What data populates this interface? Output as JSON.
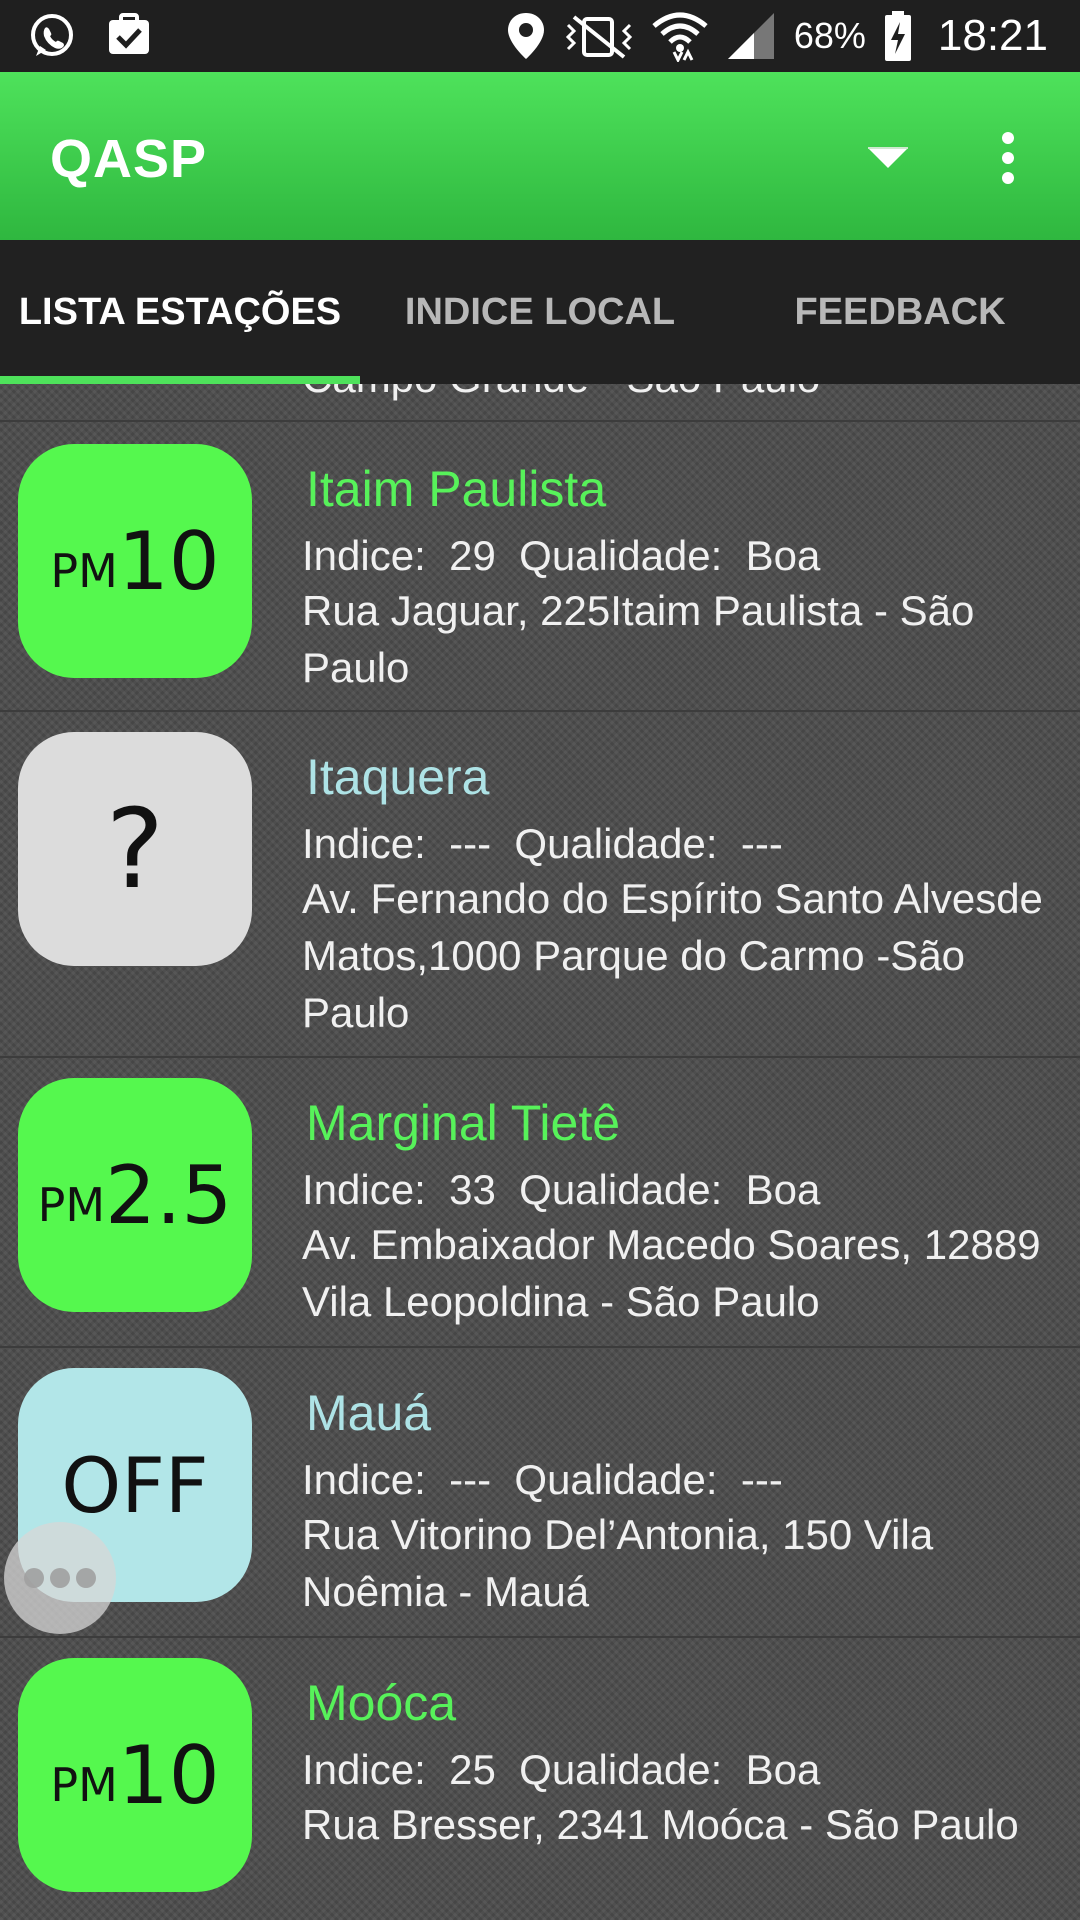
{
  "status_bar": {
    "battery": "68%",
    "time": "18:21",
    "icons": [
      "whatsapp-icon",
      "clipboard-check-icon",
      "location-icon",
      "vibrate-off-icon",
      "wifi-icon",
      "signal-icon",
      "battery-charging-icon"
    ]
  },
  "app_bar": {
    "title": "QASP",
    "icons": [
      "dropdown-icon",
      "overflow-menu-icon"
    ]
  },
  "tabs": [
    {
      "label": "LISTA ESTAÇÕES",
      "active": true
    },
    {
      "label": "INDICE LOCAL",
      "active": false
    },
    {
      "label": "FEEDBACK",
      "active": false
    }
  ],
  "list": {
    "partial_address": "Campo Grande - São Paulo",
    "labels": {
      "indice": "Indice:",
      "qualidade": "Qualidade:"
    },
    "stations": [
      {
        "name": "Itaim Paulista",
        "name_color": "#57f25a",
        "badge": {
          "prefix": "PM",
          "value": "10",
          "color": "#55f84e"
        },
        "indice": "29",
        "qualidade": "Boa",
        "address": "Rua Jaguar, 225Itaim Paulista - São Paulo"
      },
      {
        "name": "Itaquera",
        "name_color": "#aee3e6",
        "badge": {
          "prefix": "",
          "value": "?",
          "color": "#dcdcdc"
        },
        "indice": "---",
        "qualidade": "---",
        "address": "Av. Fernando do Espírito Santo Alvesde Matos,1000 Parque do Carmo -São Paulo"
      },
      {
        "name": "Marginal Tietê",
        "name_color": "#57f25a",
        "badge": {
          "prefix": "PM",
          "value": "2.5",
          "color": "#55f84e"
        },
        "indice": "33",
        "qualidade": "Boa",
        "address": "Av. Embaixador Macedo Soares, 12889 Vila Leopoldina - São Paulo"
      },
      {
        "name": "Mauá",
        "name_color": "#aee3e6",
        "badge": {
          "prefix": "",
          "value": "OFF",
          "color": "#b2e6e8"
        },
        "indice": "---",
        "qualidade": "---",
        "address": "Rua Vitorino Del’Antonia, 150 Vila Noêmia - Mauá"
      },
      {
        "name": "Moóca",
        "name_color": "#57f25a",
        "badge": {
          "prefix": "PM",
          "value": "10",
          "color": "#55f84e"
        },
        "indice": "25",
        "qualidade": "Boa",
        "address": "Rua Bresser, 2341 Moóca - São Paulo"
      }
    ]
  }
}
